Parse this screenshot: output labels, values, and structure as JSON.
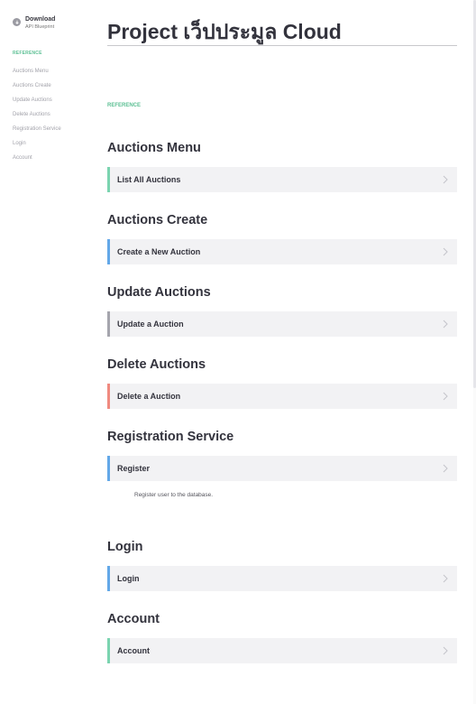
{
  "sidebar": {
    "download_title": "Download",
    "download_sub": "API Blueprint",
    "reference_label": "REFERENCE",
    "links": [
      "Auctions Menu",
      "Auctions Create",
      "Update Auctions",
      "Delete Auctions",
      "Registration Service",
      "Login",
      "Account"
    ]
  },
  "main": {
    "title": "Project เว็ปประมูล Cloud",
    "reference_label": "REFERENCE",
    "sections": [
      {
        "title": "Auctions Menu",
        "endpoint": "List All Auctions",
        "color": "#7bd4b0"
      },
      {
        "title": "Auctions Create",
        "endpoint": "Create a New Auction",
        "color": "#63a8e8"
      },
      {
        "title": "Update Auctions",
        "endpoint": "Update a Auction",
        "color": "#a5a5ad"
      },
      {
        "title": "Delete Auctions",
        "endpoint": "Delete a Auction",
        "color": "#f08a80"
      },
      {
        "title": "Registration Service",
        "endpoint": "Register",
        "color": "#63a8e8",
        "description": "Register user to the database."
      },
      {
        "title": "Login",
        "endpoint": "Login",
        "color": "#63a8e8"
      },
      {
        "title": "Account",
        "endpoint": "Account",
        "color": "#7bd4b0"
      }
    ]
  },
  "icons": {
    "download": "download-icon",
    "chevron": "chevron-right-icon"
  }
}
